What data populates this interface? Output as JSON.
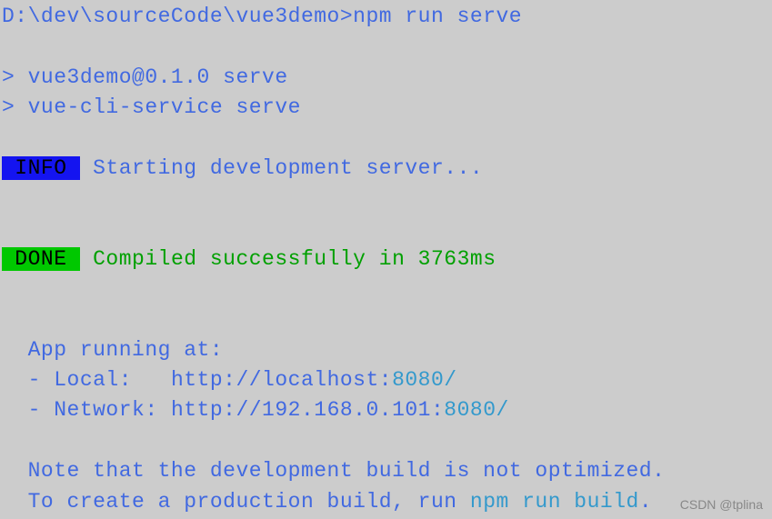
{
  "prompt": {
    "path": "D:\\dev\\sourceCode\\vue3demo>",
    "command": "npm run serve"
  },
  "script_lines": {
    "line1": "> vue3demo@0.1.0 serve",
    "line2": "> vue-cli-service serve"
  },
  "info": {
    "badge": " INFO ",
    "message": " Starting development server..."
  },
  "done": {
    "badge": " DONE ",
    "message": " Compiled successfully in 3763ms"
  },
  "app_running": {
    "heading": "  App running at:",
    "local_label": "  - Local:   ",
    "local_url_prefix": "http://localhost:",
    "local_port": "8080",
    "local_url_suffix": "/",
    "network_label": "  - Network: ",
    "network_url_prefix": "http://192.168.0.101:",
    "network_port": "8080",
    "network_url_suffix": "/"
  },
  "note": {
    "line1": "  Note that the development build is not optimized.",
    "line2_prefix": "  To create a production build, run ",
    "line2_command": "npm run build",
    "line2_suffix": "."
  },
  "watermark": "CSDN @tplina"
}
